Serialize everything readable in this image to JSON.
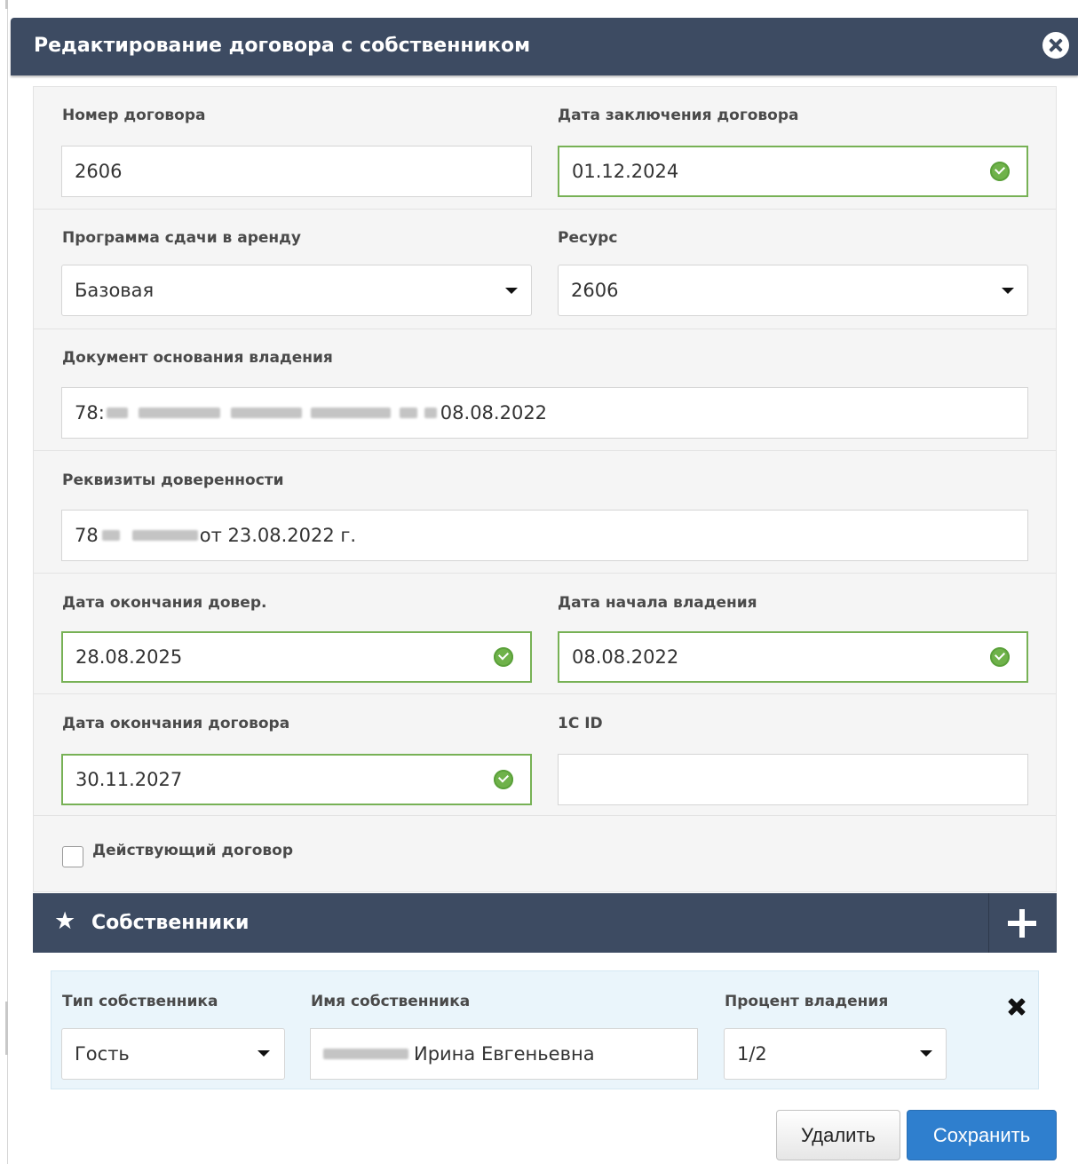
{
  "dialog": {
    "title": "Редактирование договора с собственником"
  },
  "form": {
    "contract_number": {
      "label": "Номер договора",
      "value": "2606"
    },
    "contract_date": {
      "label": "Дата заключения договора",
      "value": "01.12.2024"
    },
    "rental_program": {
      "label": "Программа сдачи в аренду",
      "value": "Базовая"
    },
    "resource": {
      "label": "Ресурс",
      "value": "2606"
    },
    "ownership_document": {
      "label": "Документ основания владения",
      "value_prefix": "78:",
      "value_suffix": "08.08.2022"
    },
    "power_of_attorney": {
      "label": "Реквизиты доверенности",
      "value_prefix": "78",
      "value_suffix": "от 23.08.2022 г."
    },
    "poa_end_date": {
      "label": "Дата окончания довер.",
      "value": "28.08.2025"
    },
    "ownership_start_date": {
      "label": "Дата начала владения",
      "value": "08.08.2022"
    },
    "contract_end_date": {
      "label": "Дата окончания договора",
      "value": "30.11.2027"
    },
    "id_1c": {
      "label": "1C ID",
      "value": ""
    },
    "active_contract": {
      "label": "Действующий договор",
      "checked": false
    }
  },
  "owners": {
    "title": "Собственники",
    "rows": [
      {
        "type_label": "Тип собственника",
        "type_value": "Гость",
        "name_label": "Имя собственника",
        "name_value": "Ирина Евгеньевна",
        "share_label": "Процент владения",
        "share_value": "1/2"
      }
    ]
  },
  "actions": {
    "delete_label": "Удалить",
    "save_label": "Сохранить"
  },
  "colors": {
    "header_bg": "#3d4b62",
    "valid_border": "#77b155",
    "save_button": "#2f7fce"
  }
}
